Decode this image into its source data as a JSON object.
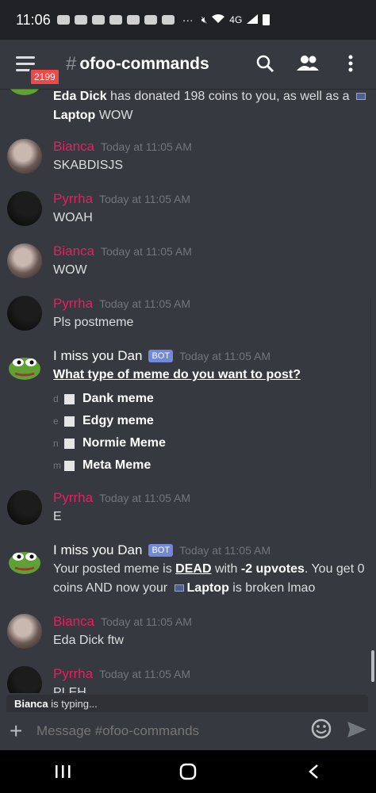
{
  "status_bar": {
    "time": "11:06",
    "network": "4G"
  },
  "header": {
    "badge_count": "2199",
    "hash": "#",
    "channel": "ofoo-commands"
  },
  "messages": [
    {
      "author": "",
      "text_prefix": "Eda Dick",
      "text": " has donated 198 coins to you, as well as a ",
      "item": "Laptop",
      "suffix": " WOW"
    },
    {
      "author": "Bianca",
      "timestamp": "Today at 11:05 AM",
      "text": "SKABDISJS"
    },
    {
      "author": "Pyrrha",
      "timestamp": "Today at 11:05 AM",
      "text": "WOAH"
    },
    {
      "author": "Bianca",
      "timestamp": "Today at 11:05 AM",
      "text": "WOW"
    },
    {
      "author": "Pyrrha",
      "timestamp": "Today at 11:05 AM",
      "text": "Pls postmeme"
    },
    {
      "author": "I miss you Dan",
      "bot_tag": "BOT",
      "timestamp": "Today at 11:05 AM",
      "question": "What type of meme do you want to post?",
      "options": [
        {
          "letter": "d",
          "label": "Dank meme"
        },
        {
          "letter": "e",
          "label": "Edgy meme"
        },
        {
          "letter": "n",
          "label": "Normie Meme"
        },
        {
          "letter": "m",
          "label": "Meta Meme"
        }
      ]
    },
    {
      "author": "Pyrrha",
      "timestamp": "Today at 11:05 AM",
      "text": "E"
    },
    {
      "author": "I miss you Dan",
      "bot_tag": "BOT",
      "timestamp": "Today at 11:05 AM",
      "t1": "Your posted meme is ",
      "dead": "DEAD",
      "t2": " with ",
      "upvotes": "-2 upvotes",
      "t3": ". You get 0 coins AND now your ",
      "item": "Laptop",
      "t4": " is broken lmao"
    },
    {
      "author": "Bianca",
      "timestamp": "Today at 11:05 AM",
      "text": "Eda Dick ftw"
    },
    {
      "author": "Pyrrha",
      "timestamp": "Today at 11:05 AM",
      "text": "PLEH"
    }
  ],
  "typing": {
    "user": "Bianca",
    "text": " is typing..."
  },
  "composer": {
    "placeholder": "Message #ofoo-commands"
  },
  "colors": {
    "accent": "#7289da",
    "author_red": "#e91e63",
    "background": "#36393f"
  }
}
